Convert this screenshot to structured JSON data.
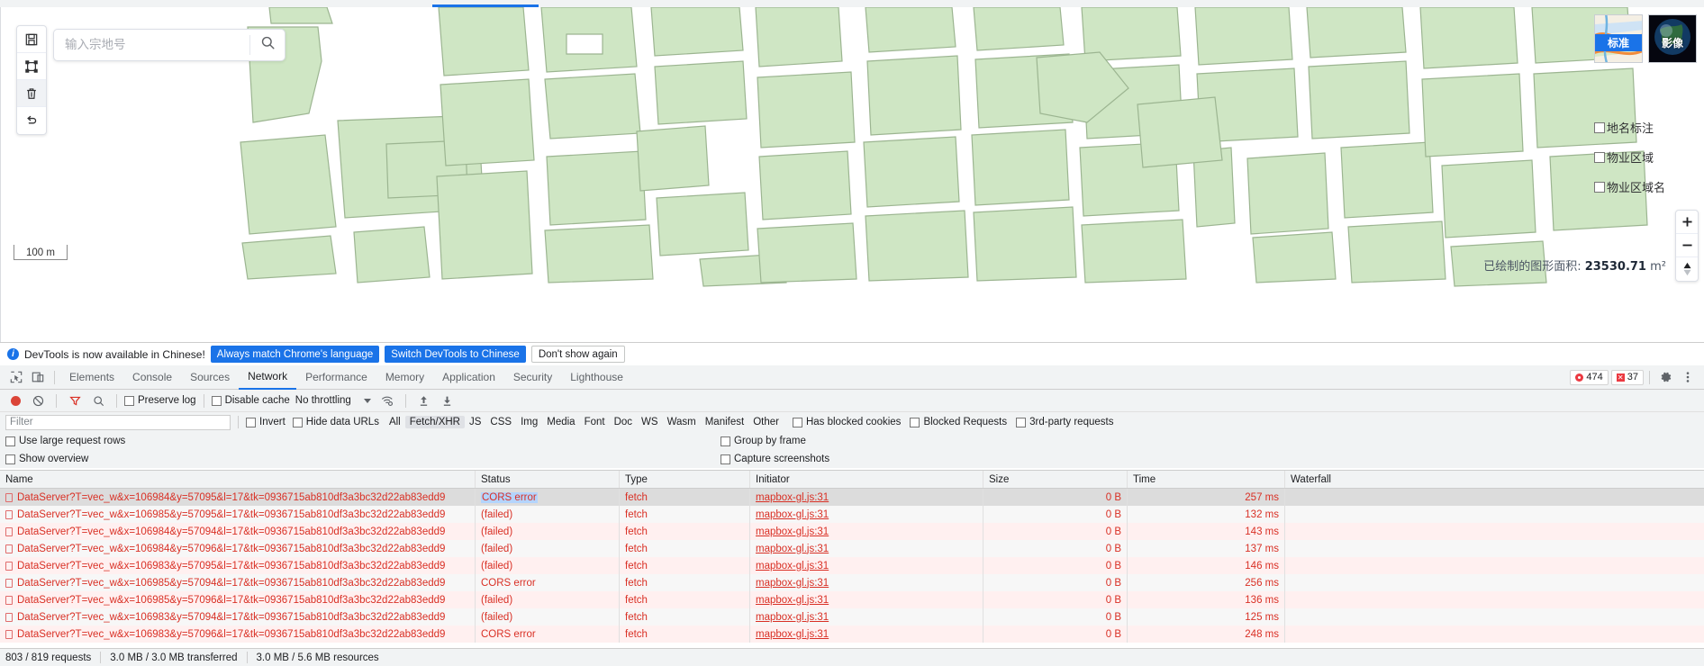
{
  "map": {
    "tools": [
      {
        "name": "save-tool",
        "icon": "save-icon",
        "active": false
      },
      {
        "name": "frame-tool",
        "icon": "frame-icon",
        "active": false
      },
      {
        "name": "delete-tool",
        "icon": "trash-icon",
        "active": true
      },
      {
        "name": "undo-tool",
        "icon": "undo-icon",
        "active": false
      }
    ],
    "search": {
      "placeholder": "输入宗地号",
      "value": "",
      "button_icon": "search-icon"
    },
    "scale": {
      "label": "100 m"
    },
    "basemaps": [
      {
        "label": "标准",
        "selected": true
      },
      {
        "label": "影像",
        "selected": false
      }
    ],
    "layer_checkboxes": [
      {
        "label": "地名标注",
        "checked": false
      },
      {
        "label": "物业区域",
        "checked": false
      },
      {
        "label": "物业区域名",
        "checked": false
      }
    ],
    "zoom_controls": [
      {
        "name": "zoom-in-button",
        "glyph": "+"
      },
      {
        "name": "zoom-out-button",
        "glyph": "−"
      },
      {
        "name": "compass-button",
        "glyph": "▲▼"
      }
    ],
    "area_readout": {
      "label": "已绘制的图形面积:",
      "value": "23530.71",
      "unit": "m²"
    },
    "colors": {
      "parcel_fill": "#cfe6c4",
      "parcel_stroke": "#9cb591",
      "accent": "#1a73e8"
    }
  },
  "devtools_notice": {
    "message": "DevTools is now available in Chinese!",
    "buttons": [
      {
        "label": "Always match Chrome's language",
        "style": "primary"
      },
      {
        "label": "Switch DevTools to Chinese",
        "style": "primary"
      },
      {
        "label": "Don't show again",
        "style": "ghost"
      }
    ]
  },
  "devtools_tabs": {
    "items": [
      {
        "label": "Elements",
        "selected": false
      },
      {
        "label": "Console",
        "selected": false
      },
      {
        "label": "Sources",
        "selected": false
      },
      {
        "label": "Network",
        "selected": true
      },
      {
        "label": "Performance",
        "selected": false
      },
      {
        "label": "Memory",
        "selected": false
      },
      {
        "label": "Application",
        "selected": false
      },
      {
        "label": "Security",
        "selected": false
      },
      {
        "label": "Lighthouse",
        "selected": false
      }
    ],
    "error_count": "474",
    "warning_count": "37"
  },
  "network_toolbar": {
    "preserve_log": {
      "label": "Preserve log",
      "checked": false
    },
    "disable_cache": {
      "label": "Disable cache",
      "checked": false
    },
    "throttling": {
      "value": "No throttling"
    }
  },
  "filter_row": {
    "filter_placeholder": "Filter",
    "filter_value": "",
    "invert": {
      "label": "Invert",
      "checked": false
    },
    "hide_data_urls": {
      "label": "Hide data URLs",
      "checked": false
    },
    "types": [
      {
        "label": "All",
        "selected": false
      },
      {
        "label": "Fetch/XHR",
        "selected": true
      },
      {
        "label": "JS",
        "selected": false
      },
      {
        "label": "CSS",
        "selected": false
      },
      {
        "label": "Img",
        "selected": false
      },
      {
        "label": "Media",
        "selected": false
      },
      {
        "label": "Font",
        "selected": false
      },
      {
        "label": "Doc",
        "selected": false
      },
      {
        "label": "WS",
        "selected": false
      },
      {
        "label": "Wasm",
        "selected": false
      },
      {
        "label": "Manifest",
        "selected": false
      },
      {
        "label": "Other",
        "selected": false
      }
    ],
    "has_blocked_cookies": {
      "label": "Has blocked cookies",
      "checked": false
    },
    "blocked_requests": {
      "label": "Blocked Requests",
      "checked": false
    },
    "third_party": {
      "label": "3rd-party requests",
      "checked": false
    }
  },
  "options": {
    "use_large_request_rows": {
      "label": "Use large request rows",
      "checked": false
    },
    "group_by_frame": {
      "label": "Group by frame",
      "checked": false
    },
    "show_overview": {
      "label": "Show overview",
      "checked": false
    },
    "capture_screenshots": {
      "label": "Capture screenshots",
      "checked": false
    }
  },
  "network_table": {
    "columns": [
      "Name",
      "Status",
      "Type",
      "Initiator",
      "Size",
      "Time",
      "Waterfall"
    ],
    "rows": [
      {
        "name": "DataServer?T=vec_w&x=106984&y=57095&l=17&tk=0936715ab810df3a3bc32d22ab83edd9",
        "status": "CORS error",
        "type": "fetch",
        "initiator": "mapbox-gl.js:31",
        "size": "0 B",
        "time": "257 ms",
        "selected": true
      },
      {
        "name": "DataServer?T=vec_w&x=106985&y=57095&l=17&tk=0936715ab810df3a3bc32d22ab83edd9",
        "status": "(failed)",
        "type": "fetch",
        "initiator": "mapbox-gl.js:31",
        "size": "0 B",
        "time": "132 ms",
        "selected": false
      },
      {
        "name": "DataServer?T=vec_w&x=106984&y=57094&l=17&tk=0936715ab810df3a3bc32d22ab83edd9",
        "status": "(failed)",
        "type": "fetch",
        "initiator": "mapbox-gl.js:31",
        "size": "0 B",
        "time": "143 ms",
        "selected": false
      },
      {
        "name": "DataServer?T=vec_w&x=106984&y=57096&l=17&tk=0936715ab810df3a3bc32d22ab83edd9",
        "status": "(failed)",
        "type": "fetch",
        "initiator": "mapbox-gl.js:31",
        "size": "0 B",
        "time": "137 ms",
        "selected": false
      },
      {
        "name": "DataServer?T=vec_w&x=106983&y=57095&l=17&tk=0936715ab810df3a3bc32d22ab83edd9",
        "status": "(failed)",
        "type": "fetch",
        "initiator": "mapbox-gl.js:31",
        "size": "0 B",
        "time": "146 ms",
        "selected": false
      },
      {
        "name": "DataServer?T=vec_w&x=106985&y=57094&l=17&tk=0936715ab810df3a3bc32d22ab83edd9",
        "status": "CORS error",
        "type": "fetch",
        "initiator": "mapbox-gl.js:31",
        "size": "0 B",
        "time": "256 ms",
        "selected": false
      },
      {
        "name": "DataServer?T=vec_w&x=106985&y=57096&l=17&tk=0936715ab810df3a3bc32d22ab83edd9",
        "status": "(failed)",
        "type": "fetch",
        "initiator": "mapbox-gl.js:31",
        "size": "0 B",
        "time": "136 ms",
        "selected": false
      },
      {
        "name": "DataServer?T=vec_w&x=106983&y=57094&l=17&tk=0936715ab810df3a3bc32d22ab83edd9",
        "status": "(failed)",
        "type": "fetch",
        "initiator": "mapbox-gl.js:31",
        "size": "0 B",
        "time": "125 ms",
        "selected": false
      },
      {
        "name": "DataServer?T=vec_w&x=106983&y=57096&l=17&tk=0936715ab810df3a3bc32d22ab83edd9",
        "status": "CORS error",
        "type": "fetch",
        "initiator": "mapbox-gl.js:31",
        "size": "0 B",
        "time": "248 ms",
        "selected": false
      }
    ]
  },
  "network_status": {
    "requests": "803 / 819 requests",
    "transferred": "3.0 MB / 3.0 MB transferred",
    "resources": "3.0 MB / 5.6 MB resources"
  }
}
